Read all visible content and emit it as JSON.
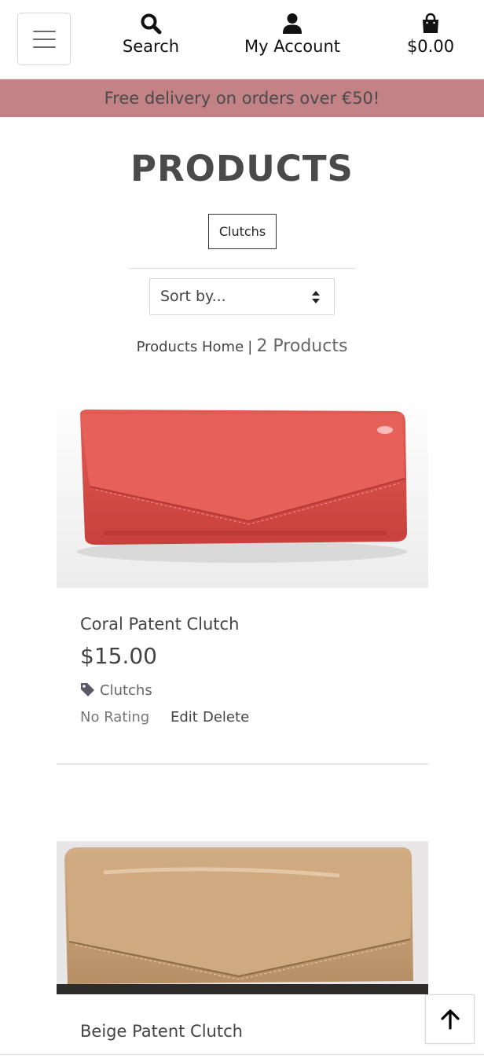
{
  "header": {
    "search_label": "Search",
    "account_label": "My Account",
    "bag_total": "$0.00",
    "icons": {
      "menu": "hamburger-menu-icon",
      "search": "search-icon",
      "account": "user-icon",
      "bag": "shopping-bag-icon"
    }
  },
  "promo": {
    "text": "Free delivery on orders over €50!",
    "bg_color": "#c38286"
  },
  "page": {
    "title": "PRODUCTS",
    "active_category": "Clutchs"
  },
  "sort": {
    "selected": "Sort by..."
  },
  "results": {
    "home_link": "Products Home",
    "separator": "|",
    "count": "2 Products"
  },
  "products": [
    {
      "name": "Coral Patent Clutch",
      "price": "$15.00",
      "category": "Clutchs",
      "rating": "No Rating",
      "edit_label": "Edit",
      "delete_label": "Delete",
      "color": "#d8534f"
    },
    {
      "name": "Beige Patent Clutch",
      "color": "#c9a47a"
    }
  ],
  "back_to_top": {
    "icon": "arrow-up-icon"
  }
}
